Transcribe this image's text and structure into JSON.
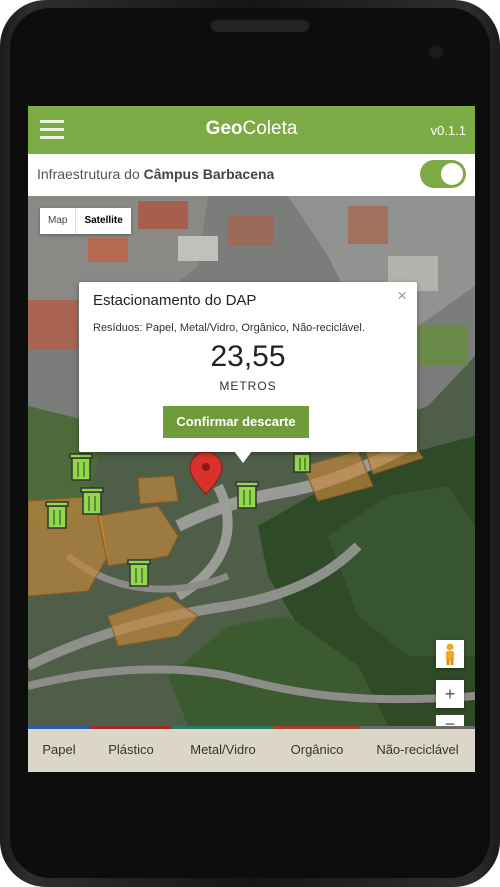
{
  "app": {
    "title_geo": "Geo",
    "title_coleta": "Coleta",
    "version": "v0.1.1"
  },
  "infra": {
    "prefix": "Infraestrutura do ",
    "campus": "Câmpus Barbacena",
    "toggle_on": true
  },
  "map": {
    "type_map": "Map",
    "type_satellite": "Satellite",
    "zoom_in": "+",
    "zoom_out": "−",
    "popup": {
      "title": "Estacionamento do DAP",
      "residuos": "Resíduos: Papel, Metal/Vidro, Orgânico, Não-reciclável.",
      "distance": "23,55",
      "unit": "METROS",
      "confirm_label": "Confirmar descarte",
      "close": "×"
    }
  },
  "tabs": [
    {
      "label": "Papel",
      "color": "#2a5aa8"
    },
    {
      "label": "Plástico",
      "color": "#a02a2a"
    },
    {
      "label": "Metal/Vidro",
      "color": "#2a7a68"
    },
    {
      "label": "Orgânico",
      "color": "#a0402a"
    },
    {
      "label": "Não-reciclável",
      "color": "#6b6b6b"
    }
  ],
  "colors": {
    "primary": "#7cab46",
    "button": "#6f9b3b",
    "bin": "#8fd94a",
    "pin": "#d9322a"
  }
}
